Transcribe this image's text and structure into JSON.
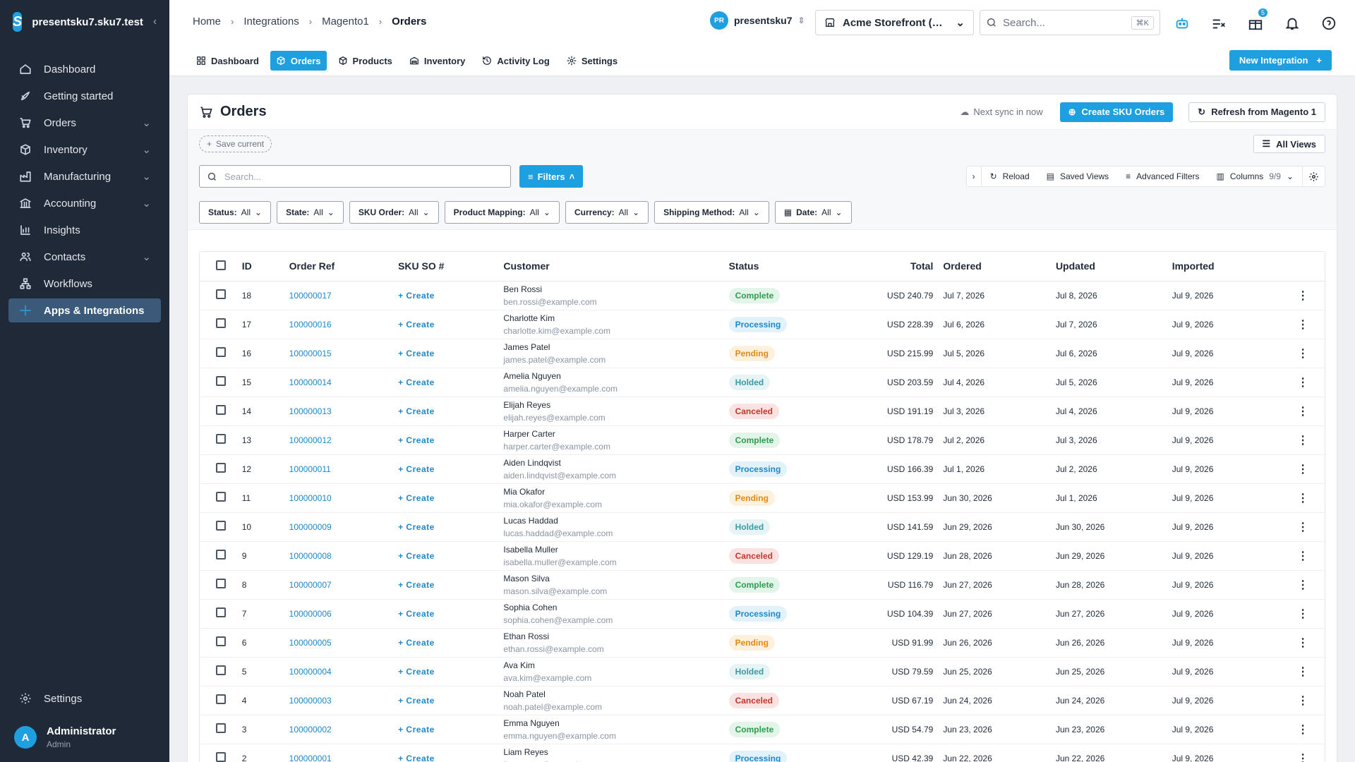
{
  "brand": {
    "name": "presentsku7.sku7.test"
  },
  "sidebar": {
    "items": [
      {
        "label": "Dashboard",
        "icon": "home-icon",
        "chev": false,
        "active": false
      },
      {
        "label": "Getting started",
        "icon": "rocket-icon",
        "chev": false,
        "active": false
      },
      {
        "label": "Orders",
        "icon": "cart-icon",
        "chev": true,
        "active": false
      },
      {
        "label": "Inventory",
        "icon": "box-icon",
        "chev": true,
        "active": false
      },
      {
        "label": "Manufacturing",
        "icon": "factory-icon",
        "chev": true,
        "active": false
      },
      {
        "label": "Accounting",
        "icon": "bank-icon",
        "chev": true,
        "active": false
      },
      {
        "label": "Insights",
        "icon": "bar-chart-icon",
        "chev": false,
        "active": false
      },
      {
        "label": "Contacts",
        "icon": "users-icon",
        "chev": true,
        "active": false
      },
      {
        "label": "Workflows",
        "icon": "workflow-icon",
        "chev": false,
        "active": false
      },
      {
        "label": "Apps & Integrations",
        "icon": "apps-icon",
        "chev": false,
        "active": true
      }
    ],
    "settings_label": "Settings",
    "user": {
      "initial": "A",
      "name": "Administrator",
      "role": "Admin"
    }
  },
  "header": {
    "breadcrumbs": [
      "Home",
      "Integrations",
      "Magento1",
      "Orders"
    ],
    "workspace": {
      "initials": "PR",
      "name": "presentsku7"
    },
    "store": "Acme Storefront (…",
    "search_placeholder": "Search...",
    "search_shortcut": "⌘K",
    "notifications_badge": "5",
    "tabs": [
      {
        "label": "Dashboard",
        "icon": "grid-icon",
        "active": false
      },
      {
        "label": "Orders",
        "icon": "package-icon",
        "active": true
      },
      {
        "label": "Products",
        "icon": "cube-icon",
        "active": false
      },
      {
        "label": "Inventory",
        "icon": "warehouse-icon",
        "active": false
      },
      {
        "label": "Activity Log",
        "icon": "history-icon",
        "active": false
      },
      {
        "label": "Settings",
        "icon": "gear-icon",
        "active": false
      }
    ],
    "new_integration_label": "New Integration"
  },
  "page": {
    "title": "Orders",
    "next_sync": "Next sync in now",
    "create_sku_orders": "Create SKU Orders",
    "refresh_label": "Refresh from Magento 1",
    "save_current": "Save current",
    "all_views": "All Views",
    "search_placeholder": "Search...",
    "filters_label": "Filters",
    "tools": {
      "reload": "Reload",
      "saved_views": "Saved Views",
      "advanced_filters": "Advanced Filters",
      "columns": "Columns",
      "columns_count": "9/9"
    },
    "chips": [
      {
        "label": "Status:",
        "value": "All",
        "icon": false
      },
      {
        "label": "State:",
        "value": "All",
        "icon": false
      },
      {
        "label": "SKU Order:",
        "value": "All",
        "icon": false
      },
      {
        "label": "Product Mapping:",
        "value": "All",
        "icon": false
      },
      {
        "label": "Currency:",
        "value": "All",
        "icon": false
      },
      {
        "label": "Shipping Method:",
        "value": "All",
        "icon": false
      },
      {
        "label": "Date:",
        "value": "All",
        "icon": true
      }
    ]
  },
  "table": {
    "columns": [
      "ID",
      "Order Ref",
      "SKU SO #",
      "Customer",
      "Status",
      "Total",
      "Ordered",
      "Updated",
      "Imported"
    ],
    "create_label": "+ Create",
    "status_colors": {
      "Complete": {
        "bg": "#e3f5e8",
        "fg": "#2e9b4f"
      },
      "Processing": {
        "bg": "#e1f2fb",
        "fg": "#1e88c8"
      },
      "Pending": {
        "bg": "#fdf0dc",
        "fg": "#e08a1a"
      },
      "Holded": {
        "bg": "#e6f4f5",
        "fg": "#3a9aa5"
      },
      "Canceled": {
        "bg": "#fbe2e2",
        "fg": "#c0392b"
      }
    },
    "rows": [
      {
        "id": "18",
        "ref": "100000017",
        "name": "Ben Rossi",
        "email": "ben.rossi@example.com",
        "status": "Complete",
        "total": "USD 240.79",
        "ordered": "Jul 7, 2026",
        "updated": "Jul 8, 2026",
        "imported": "Jul 9, 2026"
      },
      {
        "id": "17",
        "ref": "100000016",
        "name": "Charlotte Kim",
        "email": "charlotte.kim@example.com",
        "status": "Processing",
        "total": "USD 228.39",
        "ordered": "Jul 6, 2026",
        "updated": "Jul 7, 2026",
        "imported": "Jul 9, 2026"
      },
      {
        "id": "16",
        "ref": "100000015",
        "name": "James Patel",
        "email": "james.patel@example.com",
        "status": "Pending",
        "total": "USD 215.99",
        "ordered": "Jul 5, 2026",
        "updated": "Jul 6, 2026",
        "imported": "Jul 9, 2026"
      },
      {
        "id": "15",
        "ref": "100000014",
        "name": "Amelia Nguyen",
        "email": "amelia.nguyen@example.com",
        "status": "Holded",
        "total": "USD 203.59",
        "ordered": "Jul 4, 2026",
        "updated": "Jul 5, 2026",
        "imported": "Jul 9, 2026"
      },
      {
        "id": "14",
        "ref": "100000013",
        "name": "Elijah Reyes",
        "email": "elijah.reyes@example.com",
        "status": "Canceled",
        "total": "USD 191.19",
        "ordered": "Jul 3, 2026",
        "updated": "Jul 4, 2026",
        "imported": "Jul 9, 2026"
      },
      {
        "id": "13",
        "ref": "100000012",
        "name": "Harper Carter",
        "email": "harper.carter@example.com",
        "status": "Complete",
        "total": "USD 178.79",
        "ordered": "Jul 2, 2026",
        "updated": "Jul 3, 2026",
        "imported": "Jul 9, 2026"
      },
      {
        "id": "12",
        "ref": "100000011",
        "name": "Aiden Lindqvist",
        "email": "aiden.lindqvist@example.com",
        "status": "Processing",
        "total": "USD 166.39",
        "ordered": "Jul 1, 2026",
        "updated": "Jul 2, 2026",
        "imported": "Jul 9, 2026"
      },
      {
        "id": "11",
        "ref": "100000010",
        "name": "Mia Okafor",
        "email": "mia.okafor@example.com",
        "status": "Pending",
        "total": "USD 153.99",
        "ordered": "Jun 30, 2026",
        "updated": "Jul 1, 2026",
        "imported": "Jul 9, 2026"
      },
      {
        "id": "10",
        "ref": "100000009",
        "name": "Lucas Haddad",
        "email": "lucas.haddad@example.com",
        "status": "Holded",
        "total": "USD 141.59",
        "ordered": "Jun 29, 2026",
        "updated": "Jun 30, 2026",
        "imported": "Jul 9, 2026"
      },
      {
        "id": "9",
        "ref": "100000008",
        "name": "Isabella Muller",
        "email": "isabella.muller@example.com",
        "status": "Canceled",
        "total": "USD 129.19",
        "ordered": "Jun 28, 2026",
        "updated": "Jun 29, 2026",
        "imported": "Jul 9, 2026"
      },
      {
        "id": "8",
        "ref": "100000007",
        "name": "Mason Silva",
        "email": "mason.silva@example.com",
        "status": "Complete",
        "total": "USD 116.79",
        "ordered": "Jun 27, 2026",
        "updated": "Jun 28, 2026",
        "imported": "Jul 9, 2026"
      },
      {
        "id": "7",
        "ref": "100000006",
        "name": "Sophia Cohen",
        "email": "sophia.cohen@example.com",
        "status": "Processing",
        "total": "USD 104.39",
        "ordered": "Jun 27, 2026",
        "updated": "Jun 27, 2026",
        "imported": "Jul 9, 2026"
      },
      {
        "id": "6",
        "ref": "100000005",
        "name": "Ethan Rossi",
        "email": "ethan.rossi@example.com",
        "status": "Pending",
        "total": "USD 91.99",
        "ordered": "Jun 26, 2026",
        "updated": "Jun 26, 2026",
        "imported": "Jul 9, 2026"
      },
      {
        "id": "5",
        "ref": "100000004",
        "name": "Ava Kim",
        "email": "ava.kim@example.com",
        "status": "Holded",
        "total": "USD 79.59",
        "ordered": "Jun 25, 2026",
        "updated": "Jun 25, 2026",
        "imported": "Jul 9, 2026"
      },
      {
        "id": "4",
        "ref": "100000003",
        "name": "Noah Patel",
        "email": "noah.patel@example.com",
        "status": "Canceled",
        "total": "USD 67.19",
        "ordered": "Jun 24, 2026",
        "updated": "Jun 24, 2026",
        "imported": "Jul 9, 2026"
      },
      {
        "id": "3",
        "ref": "100000002",
        "name": "Emma Nguyen",
        "email": "emma.nguyen@example.com",
        "status": "Complete",
        "total": "USD 54.79",
        "ordered": "Jun 23, 2026",
        "updated": "Jun 23, 2026",
        "imported": "Jul 9, 2026"
      },
      {
        "id": "2",
        "ref": "100000001",
        "name": "Liam Reyes",
        "email": "liam.reyes@example.com",
        "status": "Processing",
        "total": "USD 42.39",
        "ordered": "Jun 22, 2026",
        "updated": "Jun 22, 2026",
        "imported": "Jul 9, 2026"
      }
    ]
  }
}
